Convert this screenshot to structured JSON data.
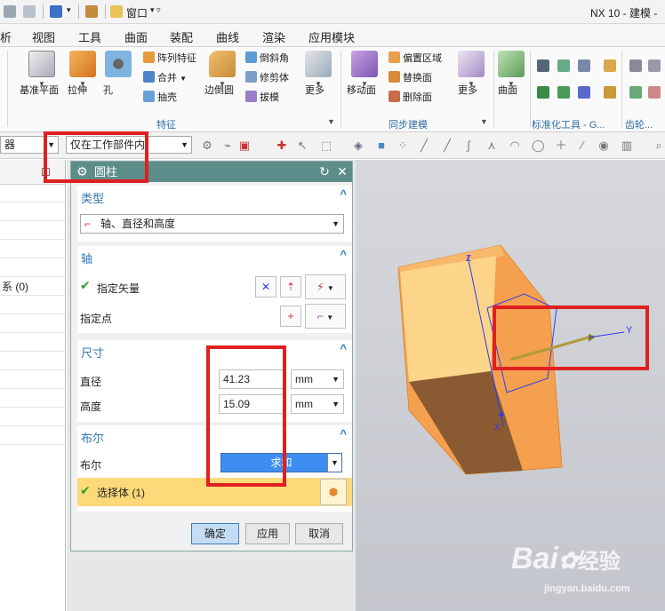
{
  "titlebar": {
    "window_menu": "窗口",
    "app_title": "NX 10 - 建模 -"
  },
  "menubar": {
    "items": [
      "析",
      "视图",
      "工具",
      "曲面",
      "装配",
      "曲线",
      "渲染",
      "应用模块"
    ]
  },
  "ribbon": {
    "big_buttons": {
      "datum_plane": "基准平面",
      "extrude": "拉伸",
      "hole": "孔",
      "edge_blend": "边倒圆",
      "more_feature": "更多",
      "move_face": "移动面",
      "more_sync": "更多",
      "surface": "曲面"
    },
    "small_buttons": {
      "pattern_feature": "阵列特征",
      "unite": "合并",
      "shell": "抽壳",
      "chamfer": "倒斜角",
      "trim_body": "修剪体",
      "draft": "拔模",
      "offset_region": "偏置区域",
      "replace_face": "替换面",
      "delete_face": "删除面"
    },
    "groups": {
      "feature": "特征",
      "sync_modeling": "同步建模",
      "standard_tools": "标准化工具 - G...",
      "gear": "齿轮..."
    }
  },
  "seltoolbar": {
    "filter": "器",
    "scope": "仅在工作部件内"
  },
  "navigator": {
    "coord_item": "系 (0)"
  },
  "dialog": {
    "title": "圆柱",
    "type_section": {
      "title": "类型",
      "value": "轴、直径和高度"
    },
    "axis_section": {
      "title": "轴",
      "specify_vector": "指定矢量",
      "specify_point": "指定点"
    },
    "dimensions_section": {
      "title": "尺寸",
      "diameter_label": "直径",
      "diameter_value": "41.23",
      "diameter_unit": "mm",
      "height_label": "高度",
      "height_value": "15.09",
      "height_unit": "mm"
    },
    "boolean_section": {
      "title": "布尔",
      "boolean_label": "布尔",
      "boolean_value": "求和",
      "select_body": "选择体 (1)"
    },
    "buttons": {
      "ok": "确定",
      "apply": "应用",
      "cancel": "取消"
    }
  },
  "viewport": {
    "axis_z": "Z",
    "axis_y": "Y",
    "axis_x": "X"
  },
  "watermark": {
    "brand": "Bai",
    "brand_cn": "经验",
    "url": "jingyan.baidu.com"
  },
  "colors": {
    "dialog_title_bg": "#5d8d8a",
    "section_title": "#2f79b7",
    "highlight_box": "#e02020",
    "boolean_selected": "#3d8ef0",
    "selected_body_bg": "#fdd97a",
    "part_orange": "#f4a04f"
  }
}
